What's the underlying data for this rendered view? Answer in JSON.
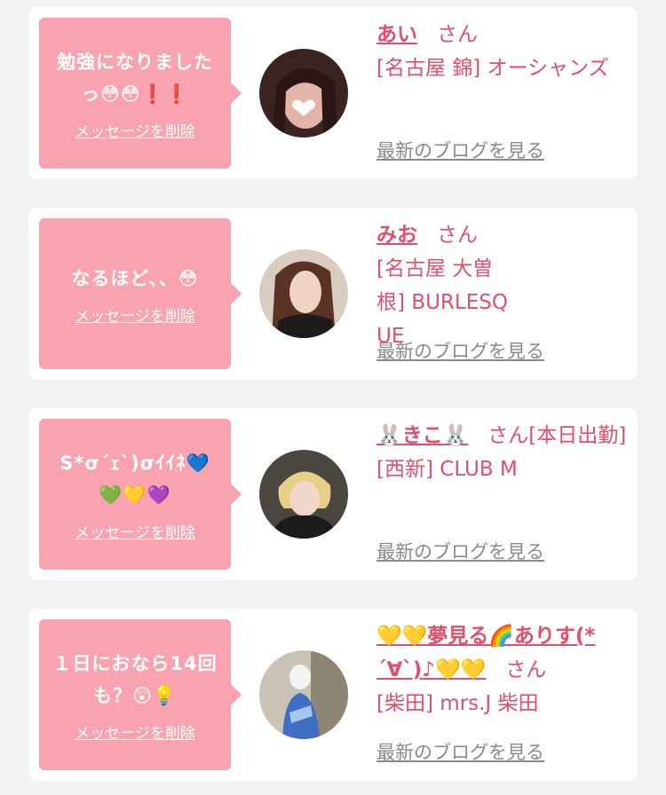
{
  "messages": [
    {
      "text": "勉強になりましたっ😳😳❗❗",
      "delete_label": "メッセージを削除",
      "name": "あい",
      "honorific": "さん",
      "shop": "[名古屋 錦] オーシャンズ",
      "blog_label": "最新のブログを見る"
    },
    {
      "text": "なるほど、、😳",
      "delete_label": "メッセージを削除",
      "name": "みお",
      "honorific": "さん",
      "shop": "[名古屋 大曽根] BURLESQUE",
      "blog_label": "最新のブログを見る"
    },
    {
      "text": "S*σ´ｪ`)σｲｲﾈ💙💚💛💜",
      "delete_label": "メッセージを削除",
      "name": "🐰きこ🐰",
      "honorific": "さん[本日出勤]",
      "shop": "[西新] CLUB M",
      "blog_label": "最新のブログを見る"
    },
    {
      "text": "１日におなら14回も？😲💡",
      "delete_label": "メッセージを削除",
      "name": "💛💛夢見る🌈ありす(*´∀`)♪💛💛",
      "honorific": "さん",
      "shop": "[柴田] mrs.J 柴田",
      "blog_label": "最新のブログを見る"
    }
  ]
}
